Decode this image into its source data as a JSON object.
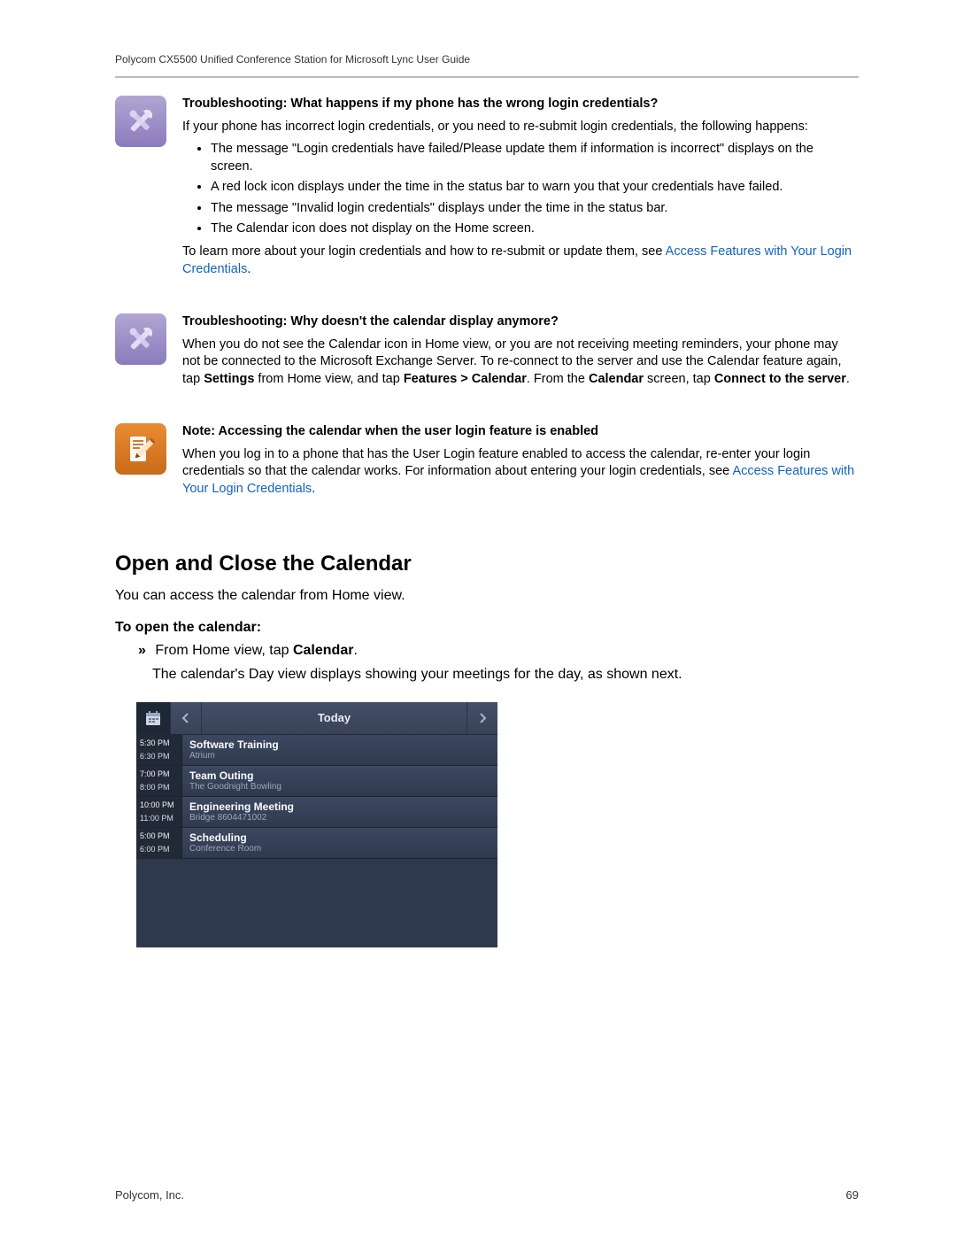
{
  "header": {
    "title": "Polycom CX5500 Unified Conference Station for Microsoft Lync User Guide"
  },
  "troubleshoot1": {
    "heading": "Troubleshooting: What happens if my phone has the wrong login credentials?",
    "intro": "If your phone has incorrect login credentials, or you need to re-submit login credentials, the following happens:",
    "bullets": [
      "The message \"Login credentials have failed/Please update them if information is incorrect\" displays on the screen.",
      "A red lock icon displays under the time in the status bar to warn you that your credentials have failed.",
      "The message \"Invalid login credentials\" displays under the time in the status bar.",
      "The Calendar icon does not display on the Home screen."
    ],
    "outro_pre": "To learn more about your login credentials and how to re-submit or update them, see ",
    "outro_link": "Access Features with Your Login Credentials",
    "outro_post": "."
  },
  "troubleshoot2": {
    "heading": "Troubleshooting: Why doesn't the calendar display anymore?",
    "body_pre": "When you do not see the Calendar icon in Home view, or you are not receiving meeting reminders, your phone may not be connected to the Microsoft Exchange Server. To re-connect to the server and use the Calendar feature again, tap ",
    "b1": "Settings",
    "mid1": " from Home view, and tap ",
    "b2": "Features > Calendar",
    "mid2": ". From the ",
    "b3": "Calendar",
    "mid3": " screen, tap ",
    "b4": "Connect to the server",
    "post": "."
  },
  "note3": {
    "heading": "Note: Accessing the calendar when the user login feature is enabled",
    "body_pre": "When you log in to a phone that has the User Login feature enabled to access the calendar, re-enter your login credentials so that the calendar works. For information about entering your login credentials, see ",
    "link": "Access Features with Your Login Credentials",
    "post": "."
  },
  "section": {
    "title": "Open and Close the Calendar",
    "intro": "You can access the calendar from Home view.",
    "subheading": "To open the calendar:",
    "step_prefix": "»",
    "step_pre": "From Home view, tap ",
    "step_bold": "Calendar",
    "step_post": ".",
    "after": "The calendar's Day view displays showing your meetings for the day, as shown next."
  },
  "calendar": {
    "today": "Today",
    "rows": [
      {
        "t1": "5:30 PM",
        "t2": "6:30 PM",
        "title": "Software Training",
        "loc": "Atrium"
      },
      {
        "t1": "7:00 PM",
        "t2": "8:00 PM",
        "title": "Team Outing",
        "loc": "The Goodnight Bowling"
      },
      {
        "t1": "10:00 PM",
        "t2": "11:00 PM",
        "title": "Engineering Meeting",
        "loc": "Bridge 8604471002"
      },
      {
        "t1": "5:00 PM",
        "t2": "6:00 PM",
        "title": "Scheduling",
        "loc": "Conference Room"
      }
    ]
  },
  "footer": {
    "company": "Polycom, Inc.",
    "page": "69"
  }
}
